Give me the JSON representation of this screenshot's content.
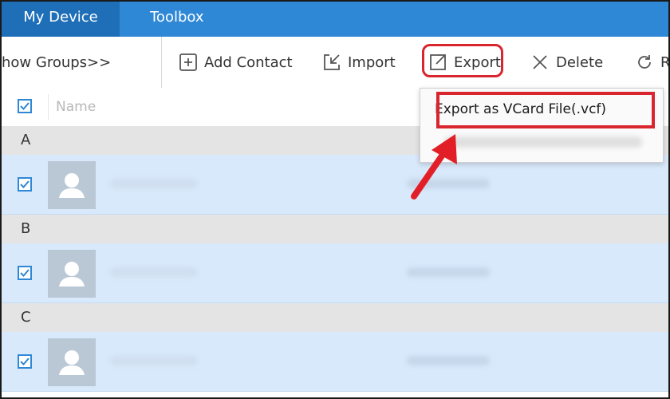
{
  "tabs": {
    "my_device": "My Device",
    "toolbox": "Toolbox"
  },
  "toolbar": {
    "show_groups": "how Groups>>",
    "add_contact": "Add Contact",
    "import": "Import",
    "export": "Export",
    "delete": "Delete",
    "refresh": "R"
  },
  "list_header": {
    "name": "Name"
  },
  "groups": [
    "A",
    "B",
    "C"
  ],
  "export_menu": {
    "vcard": "Export as VCard File(.vcf)"
  },
  "colors": {
    "accent": "#2f88d6",
    "highlight": "#d9252e",
    "row_selected": "#d8e9fb"
  }
}
